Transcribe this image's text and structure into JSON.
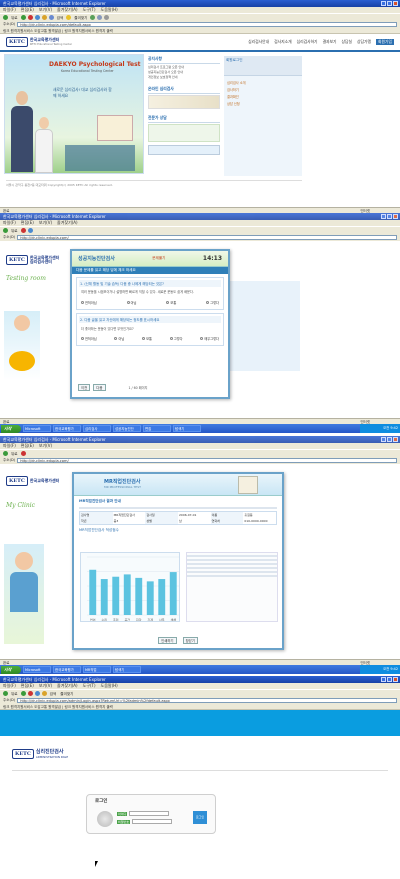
{
  "browser": {
    "title": "한국교육평가센터 심리검사 - Microsoft Internet Explorer",
    "menu": [
      "파일(F)",
      "편집(E)",
      "보기(V)",
      "즐겨찾기(A)",
      "도구(T)",
      "도움말(H)"
    ],
    "toolbar": {
      "back": "뒤로",
      "search": "검색",
      "favorites": "즐겨찾기"
    },
    "address_label": "주소(D)",
    "urls": [
      "http://dr-clinic.edupia.com/default.aspx",
      "http://dr-clinic.edupia.com/",
      "http://dr-clinic.edupia.com/",
      "http://dr-clinic.edupia.com/admin/Login.aspx?ReturnUrl=%2fadmin%2fdefault.aspx"
    ],
    "links": "링크 원격지원서비스 도감고통 원격발급 | 링크 원격지원서비스 원격지 출력",
    "status": [
      "완료",
      "인터넷"
    ],
    "go": "이동"
  },
  "taskbar": {
    "start": "시작",
    "tasks": [
      "Microsoft",
      "한국교육평가",
      "심리검사",
      "성공지능진단",
      "MR직업",
      "편집",
      "탐색기"
    ],
    "time": "오전 9:42"
  },
  "site": {
    "logo_mark": "KETC",
    "logo_name": "한국교육평가센터",
    "logo_name2": "심리검사센터",
    "logo_sub": "KETC Educational Testing Center",
    "nav": [
      "심리검사안내",
      "검사지소개",
      "심리검사하기",
      "결과보기",
      "상담실",
      "상담가맹",
      "회원가입"
    ],
    "hero": {
      "brand": "DAEKYO Psychological Test",
      "sub": "Korea Educational Testing Center",
      "slogan": "새로운 심리검사! 대교 심리검사와 함께 하세요"
    },
    "notice_title": "공지사항",
    "notice_items": [
      "심리검사 프로그램 오픈 안내",
      "성공지능진단검사 오픈 안내",
      "개인정보 보호정책 안내"
    ],
    "online_title": "온라인 심리검사",
    "counsel_title": "전문가 상담",
    "login_title": "회원로그인",
    "side_items": [
      "심리검사 소개",
      "검사하기",
      "결과확인",
      "상담 신청"
    ],
    "footer": "서울시 관악구 봉천7동 대교타워 Copyright(c) 2005 KETC All rights reserved."
  },
  "test_popup": {
    "title": "성공지능진단검사",
    "badge": "문제풀기",
    "timer": "14:13",
    "instruction": "다음 문제를 읽고 해당 답에 체크 하세요",
    "q1": "1. (신체 활동 및 기술 습득) 다음 중 나에게 해당되는 것은?",
    "q1_text": "여러 운동을 시범보이거나 설명하면 빠르게 익힐 수 있다. 새로운 운동도 쉽게 배운다.",
    "q2": "2. 다음 글을 읽고 자신에게 해당되는 정도를 표시하세요",
    "q2_text": "더 좋아하는 운동이 있다면 무엇인가요?",
    "options": [
      "전혀아님",
      "아님",
      "보통",
      "그렇다",
      "매우그렇다"
    ],
    "nav": [
      "이전",
      "다음",
      "1 / 60 페이지"
    ],
    "side_title": "Testing room"
  },
  "result_popup": {
    "title": "MR직업진단검사",
    "subtitle": "MR PROFESSIONAL TEST",
    "section": "MR직업진단검사 결과 안내",
    "fields": [
      "검사명",
      "검사일",
      "이름",
      "학년",
      "성별",
      "연락처"
    ],
    "values": [
      "MR직업진단검사",
      "2006-07-01",
      "홍길동",
      "중3",
      "남",
      "010-0000-0000"
    ],
    "chart_title": "MR직업진단검사 적성점수",
    "side_title": "My Clinic",
    "print": "인쇄하기",
    "close": "창닫기"
  },
  "chart_data": {
    "type": "bar",
    "title": "MR직업진단검사 적성점수",
    "categories": [
      "언어",
      "수리",
      "추리",
      "공간",
      "지각",
      "기계",
      "사무",
      "색채"
    ],
    "values": [
      78,
      62,
      66,
      70,
      64,
      58,
      62,
      74
    ],
    "ylim": [
      0,
      100
    ]
  },
  "admin": {
    "logo_title": "심리진단검사",
    "logo_sub": "ADMINISTRATION PAGE",
    "login_title": "로그인",
    "id_label": "아이디",
    "pw_label": "비밀번호",
    "login_btn": "로그인",
    "banner_color": "#0a9de0"
  }
}
